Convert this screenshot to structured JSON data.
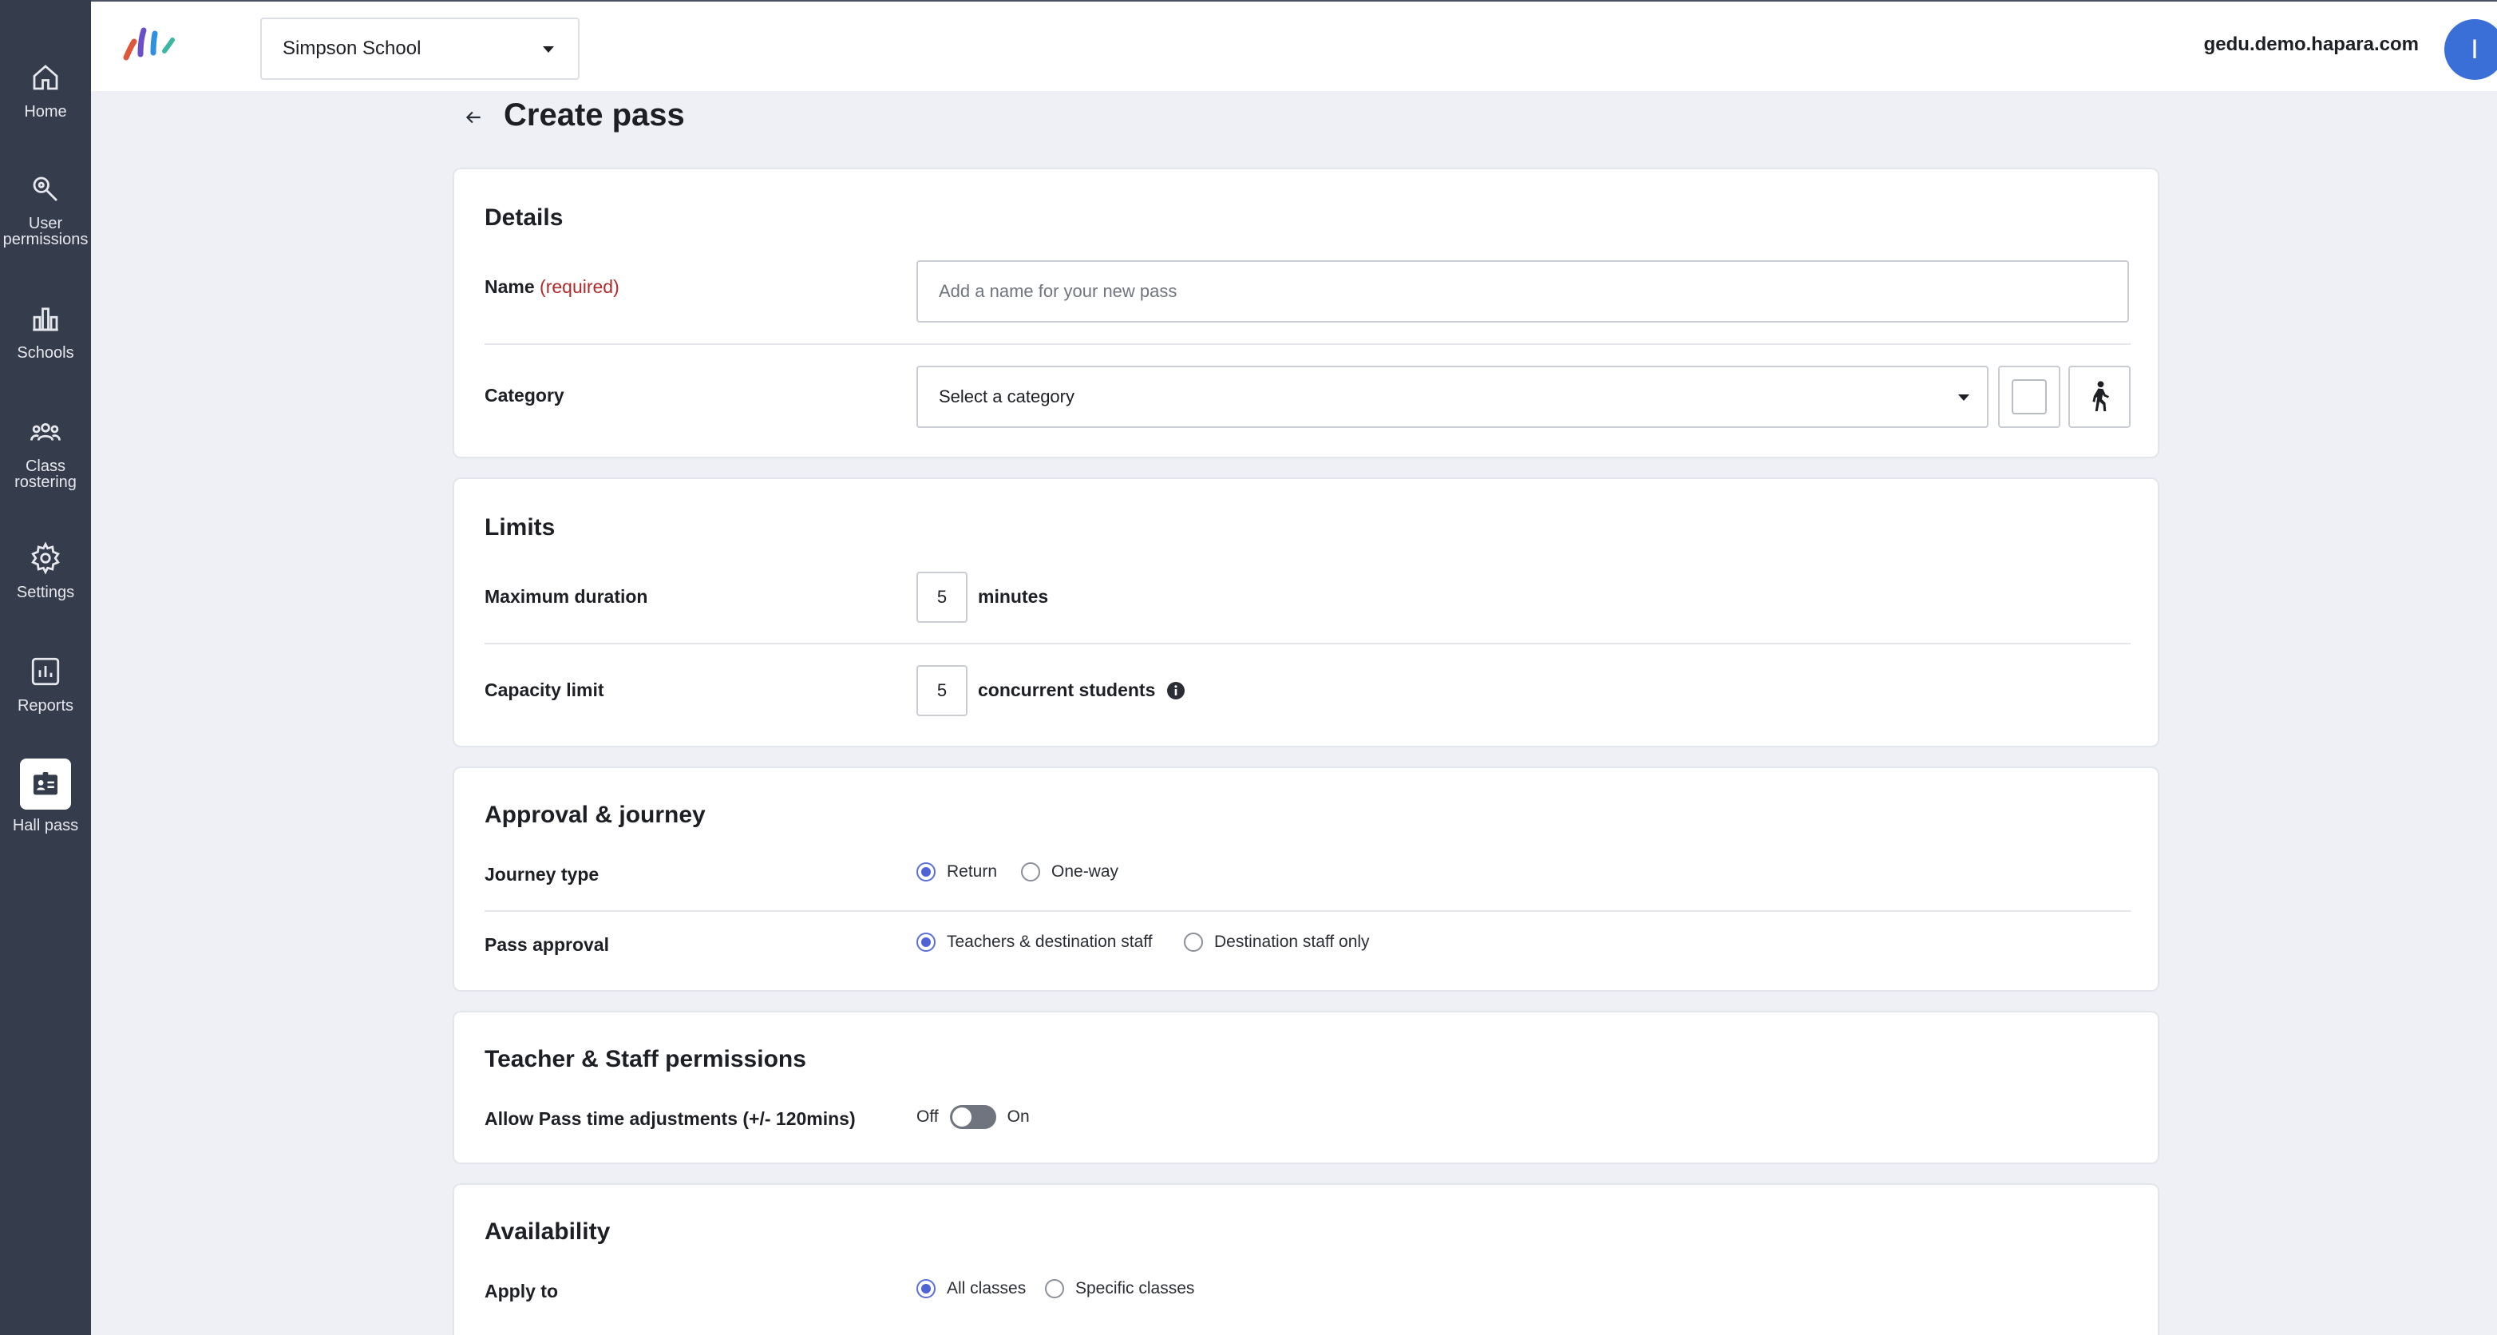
{
  "sidebar": {
    "items": [
      {
        "label": "Home",
        "icon": "home-icon"
      },
      {
        "label": "User\npermissions",
        "icon": "key-search-icon"
      },
      {
        "label": "Schools",
        "icon": "school-icon"
      },
      {
        "label": "Class\nrostering",
        "icon": "group-icon"
      },
      {
        "label": "Settings",
        "icon": "gear-icon"
      },
      {
        "label": "Reports",
        "icon": "chart-icon"
      },
      {
        "label": "Hall pass",
        "icon": "badge-icon",
        "active": true
      }
    ]
  },
  "header": {
    "school": "Simpson School",
    "domain": "gedu.demo.hapara.com",
    "avatar_initial": "I"
  },
  "page": {
    "title": "Create pass"
  },
  "details": {
    "title": "Details",
    "name_label": "Name",
    "name_required": "(required)",
    "name_placeholder": "Add a name for your new pass",
    "category_label": "Category",
    "category_placeholder": "Select a category"
  },
  "limits": {
    "title": "Limits",
    "max_duration_label": "Maximum duration",
    "max_duration_value": "5",
    "max_duration_unit": "minutes",
    "capacity_label": "Capacity limit",
    "capacity_value": "5",
    "capacity_unit": "concurrent students"
  },
  "approval": {
    "title": "Approval & journey",
    "journey_label": "Journey type",
    "journey_options": [
      "Return",
      "One-way"
    ],
    "journey_selected": "Return",
    "pass_approval_label": "Pass approval",
    "pass_approval_options": [
      "Teachers & destination staff",
      "Destination staff only"
    ],
    "pass_approval_selected": "Teachers & destination staff"
  },
  "permissions": {
    "title": "Teacher & Staff permissions",
    "adjust_label": "Allow Pass time adjustments (+/- 120mins)",
    "off_label": "Off",
    "on_label": "On",
    "adjust_enabled": false
  },
  "availability": {
    "title": "Availability",
    "apply_label": "Apply to",
    "apply_options": [
      "All classes",
      "Specific classes"
    ],
    "apply_selected": "All classes"
  },
  "colors": {
    "sidebar": "#353c4b",
    "accent": "#4f63d2",
    "required": "#b02a2a",
    "avatar": "#3a6fd8"
  }
}
